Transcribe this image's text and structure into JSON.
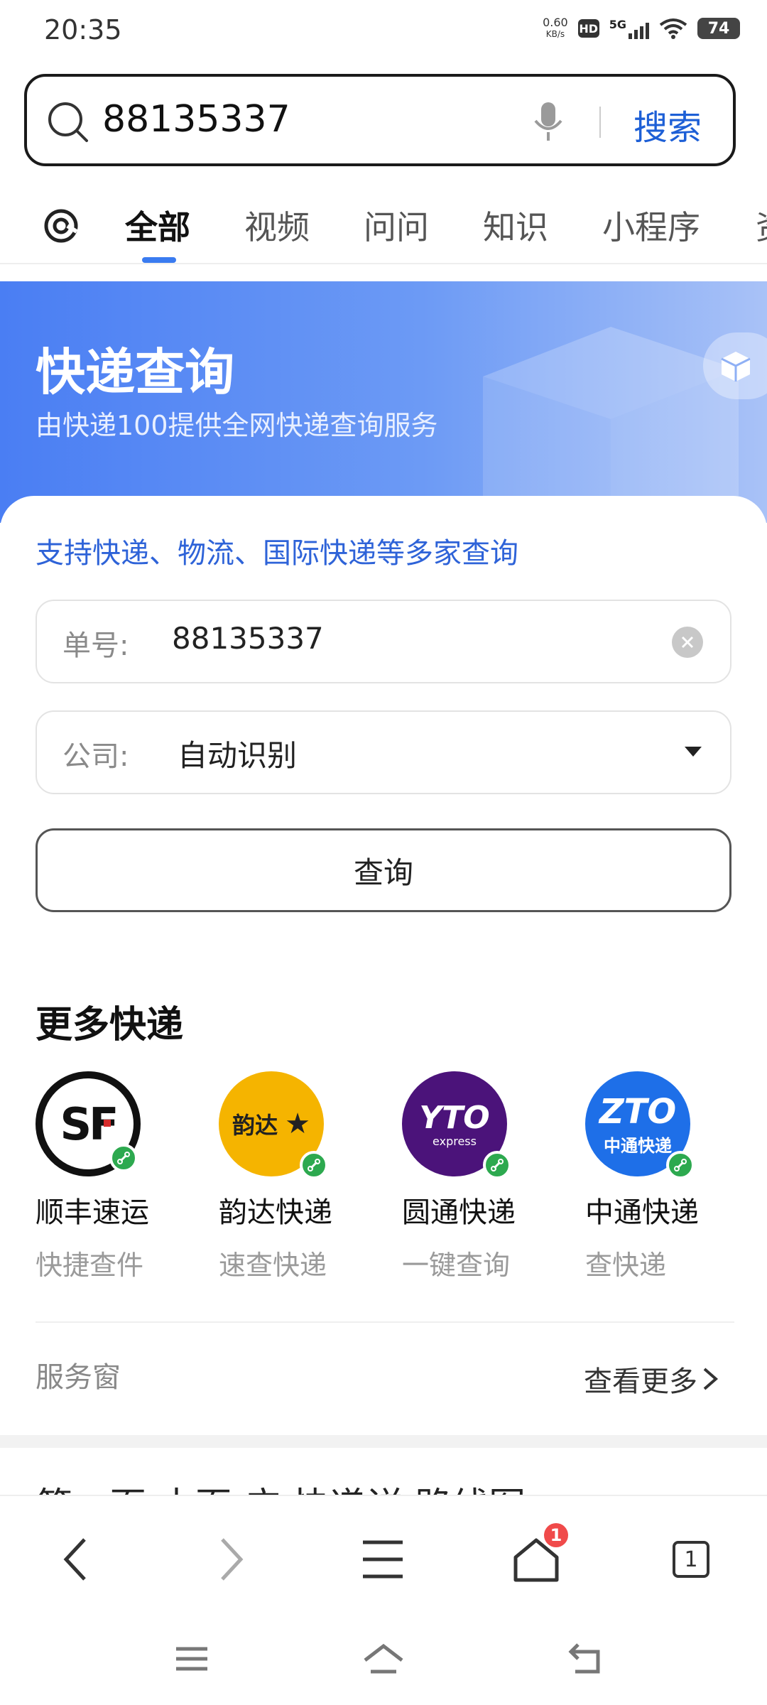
{
  "status_bar": {
    "time": "20:35",
    "net_speed_value": "0.60",
    "net_speed_unit": "KB/s",
    "hd": "HD",
    "network": "5G",
    "battery": "74"
  },
  "search": {
    "query": "88135337",
    "button_label": "搜索",
    "icons": [
      "search-icon",
      "mic-icon"
    ]
  },
  "tabs": [
    {
      "label": "全部",
      "active": true
    },
    {
      "label": "视频",
      "active": false
    },
    {
      "label": "问问",
      "active": false
    },
    {
      "label": "知识",
      "active": false
    },
    {
      "label": "小程序",
      "active": false
    },
    {
      "label": "资",
      "active": false
    }
  ],
  "hero": {
    "title": "快递查询",
    "subtitle": "由快递100提供全网快递查询服务"
  },
  "form": {
    "support_text": "支持快递、物流、国际快递等多家查询",
    "number_label": "单号:",
    "number_value": "88135337",
    "company_label": "公司:",
    "company_value": "自动识别",
    "query_button": "查询"
  },
  "more_couriers": {
    "title": "更多快递",
    "items": [
      {
        "name": "顺丰速运",
        "desc": "快捷查件",
        "logo_text": "SF",
        "color": "#111111"
      },
      {
        "name": "韵达快递",
        "desc": "速查快递",
        "logo_text": "韵达",
        "color": "#f5b400"
      },
      {
        "name": "圆通快递",
        "desc": "一键查询",
        "logo_text": "YTO",
        "logo_sub": "express",
        "color": "#4b137a"
      },
      {
        "name": "中通快递",
        "desc": "查快递",
        "logo_text": "ZTO",
        "logo_sub": "中通快递",
        "color": "#1e6fe8"
      }
    ]
  },
  "service": {
    "label": "服务窗",
    "more": "查看更多"
  },
  "next_result_peek": "第一页 本页 广 快递详 路线图",
  "bottom_bar": {
    "home_badge": "1",
    "tab_count": "1"
  },
  "colors": {
    "accent": "#1d5fd6",
    "tab_indicator": "#3a7bf0",
    "hero_start": "#4a7ef3",
    "hero_end": "#a9c2f7",
    "badge": "#f04a4a"
  }
}
